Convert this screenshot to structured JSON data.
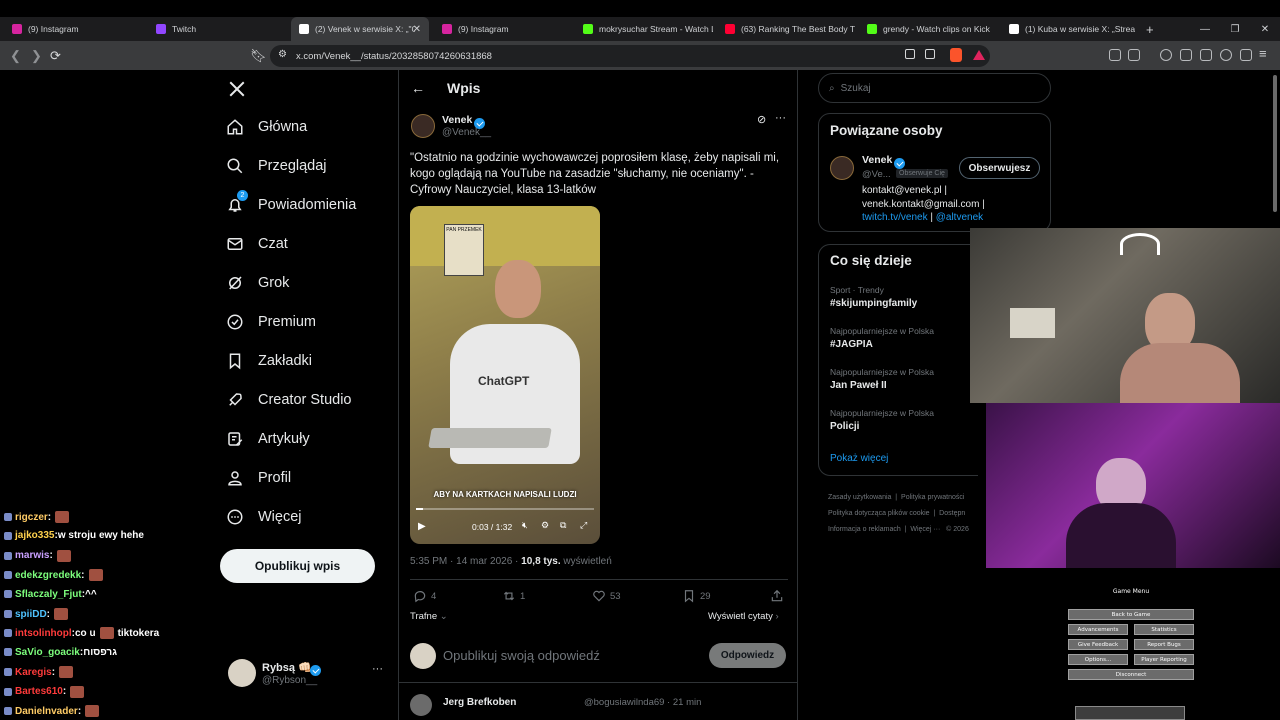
{
  "tabs": [
    {
      "title": "(9) Instagram",
      "color": "#d6249f"
    },
    {
      "title": "Twitch",
      "color": "#9146ff"
    },
    {
      "title": "(2) Venek w serwisie X: „\"O",
      "color": "#ffffff"
    },
    {
      "title": "(9) Instagram",
      "color": "#d6249f"
    },
    {
      "title": "mokrysuchar Stream - Watch L",
      "color": "#53fc18"
    },
    {
      "title": "(63) Ranking The Best Body Tre",
      "color": "#ff0033"
    },
    {
      "title": "grendy - Watch clips on Kick",
      "color": "#53fc18"
    },
    {
      "title": "(1) Kuba w serwisie X: „Stream",
      "color": "#ffffff"
    }
  ],
  "address": {
    "url": "x.com/Venek__/status/2032858074260631868"
  },
  "nav": [
    {
      "label": "Główna",
      "icon": "home-icon"
    },
    {
      "label": "Przeglądaj",
      "icon": "search-icon"
    },
    {
      "label": "Powiadomienia",
      "icon": "bell-icon",
      "badge": "2"
    },
    {
      "label": "Czat",
      "icon": "mail-icon"
    },
    {
      "label": "Grok",
      "icon": "grok-icon"
    },
    {
      "label": "Premium",
      "icon": "premium-icon"
    },
    {
      "label": "Zakładki",
      "icon": "bookmark-icon"
    },
    {
      "label": "Creator Studio",
      "icon": "rocket-icon"
    },
    {
      "label": "Artykuły",
      "icon": "article-icon"
    },
    {
      "label": "Profil",
      "icon": "person-icon"
    },
    {
      "label": "Więcej",
      "icon": "more-icon"
    }
  ],
  "post_button": "Opublikuj wpis",
  "account": {
    "name": "Rybsą 👊🏻",
    "handle": "@Rybson__"
  },
  "header": {
    "title": "Wpis"
  },
  "post": {
    "author": "Venek",
    "handle": "@Venek__",
    "text": "\"Ostatnio na godzinie wychowawczej poprosiłem klasę, żeby napisali mi, kogo oglądają na YouTube na zasadzie \"słuchamy, nie oceniamy\". - Cyfrowy Nauczyciel, klasa 13-latków",
    "video_caption": "ABY NA KARTKACH NAPISALI LUDZI",
    "video_time": "0:03 / 1:32",
    "timestamp": "5:35 PM · 14 mar 2026 · ",
    "views": "10,8 tys.",
    "views_label": " wyświetleń",
    "stats": {
      "replies": "4",
      "reposts": "1",
      "likes": "53",
      "bookmarks": "29"
    },
    "sort": "Trafne",
    "quotes": "Wyświetl cytaty",
    "video_sign": "PAN PRZEMEK",
    "shirt_text": "ChatGPT"
  },
  "reply": {
    "placeholder": "Opublikuj swoją odpowiedź",
    "button": "Odpowiedz"
  },
  "next_reply": {
    "name": "Jerg Brefkoben",
    "handle": "@bogusiawilnda69 · 21 min"
  },
  "search": {
    "placeholder": "Szukaj"
  },
  "related": {
    "title": "Powiązane osoby",
    "name": "Venek",
    "handle": "@Ve...",
    "follows_you": "Obserwuje Cię",
    "follow_button": "Obserwujesz",
    "bio1": "kontakt@venek.pl |",
    "bio2": "venek.kontakt@gmail.com |",
    "bio_link1": "twitch.tv/venek",
    "bio_sep": " | ",
    "bio_link2": "@altvenek"
  },
  "trends": {
    "title": "Co się dzieje",
    "items": [
      {
        "category": "Sport · Trendy",
        "name": "#skijumpingfamily"
      },
      {
        "category": "Najpopularniejsze w Polska",
        "name": "#JAGPIA"
      },
      {
        "category": "Najpopularniejsze w Polska",
        "name": "Jan Paweł II"
      },
      {
        "category": "Najpopularniejsze w Polska",
        "name": "Policji"
      }
    ],
    "more": "Pokaż więcej"
  },
  "footer": {
    "line1a": "Zasady użytkowania",
    "line1b": "Polityka prywatności",
    "line2a": "Polityka dotycząca plików cookie",
    "line2b": "Dostępn",
    "line3a": "Informacja o reklamach",
    "line3b": "Więcej ···",
    "line3c": "© 2026"
  },
  "chat": [
    {
      "user": "rigczer",
      "msg": "",
      "color": "#ffcc66",
      "emote": true
    },
    {
      "user": "jajko335",
      "msg": "w stroju ewy hehe",
      "color": "#ffd24d",
      "emote": false
    },
    {
      "user": "marwis",
      "msg": "",
      "color": "#c9a0ff",
      "emote": true
    },
    {
      "user": "edekzgredekk",
      "msg": "",
      "color": "#7dff7d",
      "emote": true
    },
    {
      "user": "Sflaczaly_Fjut",
      "msg": "^^",
      "color": "#7dff7d",
      "emote": false
    },
    {
      "user": "spiiDD",
      "msg": "",
      "color": "#4fc3ff",
      "emote": true
    },
    {
      "user": "intsolinhopl",
      "msg": "co u",
      "msg2": "tiktokera",
      "color": "#ff3b3b",
      "emote": true
    },
    {
      "user": "SaVio_goacik",
      "msg": "גרפסוח",
      "color": "#7dff7d",
      "emote": false
    },
    {
      "user": "Karegis",
      "msg": "",
      "color": "#ff3b3b",
      "emote": true
    },
    {
      "user": "Bartes610",
      "msg": "",
      "color": "#ff3b3b",
      "emote": true
    },
    {
      "user": "Danielnvader",
      "msg": "",
      "color": "#ffcc66",
      "emote": true
    }
  ],
  "game_menu": {
    "title": "Game Menu",
    "back": "Back to Game",
    "advancements": "Advancements",
    "statistics": "Statistics",
    "feedback": "Give Feedback",
    "bugs": "Report Bugs",
    "options": "Options...",
    "reporting": "Player Reporting",
    "disconnect": "Disconnect"
  }
}
